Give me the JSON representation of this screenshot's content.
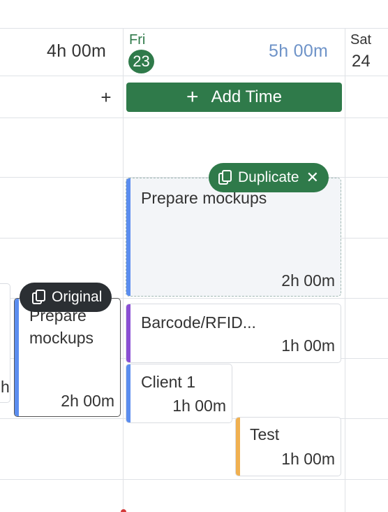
{
  "header": {
    "prev_day": {
      "total": "4h 00m"
    },
    "fri": {
      "name": "Fri",
      "number": "23",
      "total": "5h 00m"
    },
    "sat": {
      "name": "Sat",
      "number": "24"
    }
  },
  "toolbar": {
    "plus_label": "+",
    "add_time_plus": "+",
    "add_time_label": "Add Time"
  },
  "entries": {
    "dup_mockups": {
      "title": "Prepare mockups",
      "duration": "2h 00m",
      "color": "#5b8def"
    },
    "barcode": {
      "title": "Barcode/RFID...",
      "duration": "1h 00m",
      "color": "#8a4fd4"
    },
    "client": {
      "title": "Client 1",
      "duration": "1h 00m",
      "color": "#5b8def"
    },
    "test": {
      "title": "Test",
      "duration": "1h 00m",
      "color": "#f0b050"
    },
    "original_mockups": {
      "title": "Prepare mockups",
      "duration": "2h 00m",
      "color": "#5b8def"
    },
    "partial_left": {
      "duration_fragment": "h"
    }
  },
  "badges": {
    "duplicate": {
      "label": "Duplicate",
      "close": "✕",
      "color": "#2f7a4a"
    },
    "original": {
      "label": "Original",
      "color": "#2b2f33"
    }
  },
  "colors": {
    "green": "#2f7a4a",
    "blue_total": "#6e93c8",
    "grid": "#dfe2e6"
  }
}
